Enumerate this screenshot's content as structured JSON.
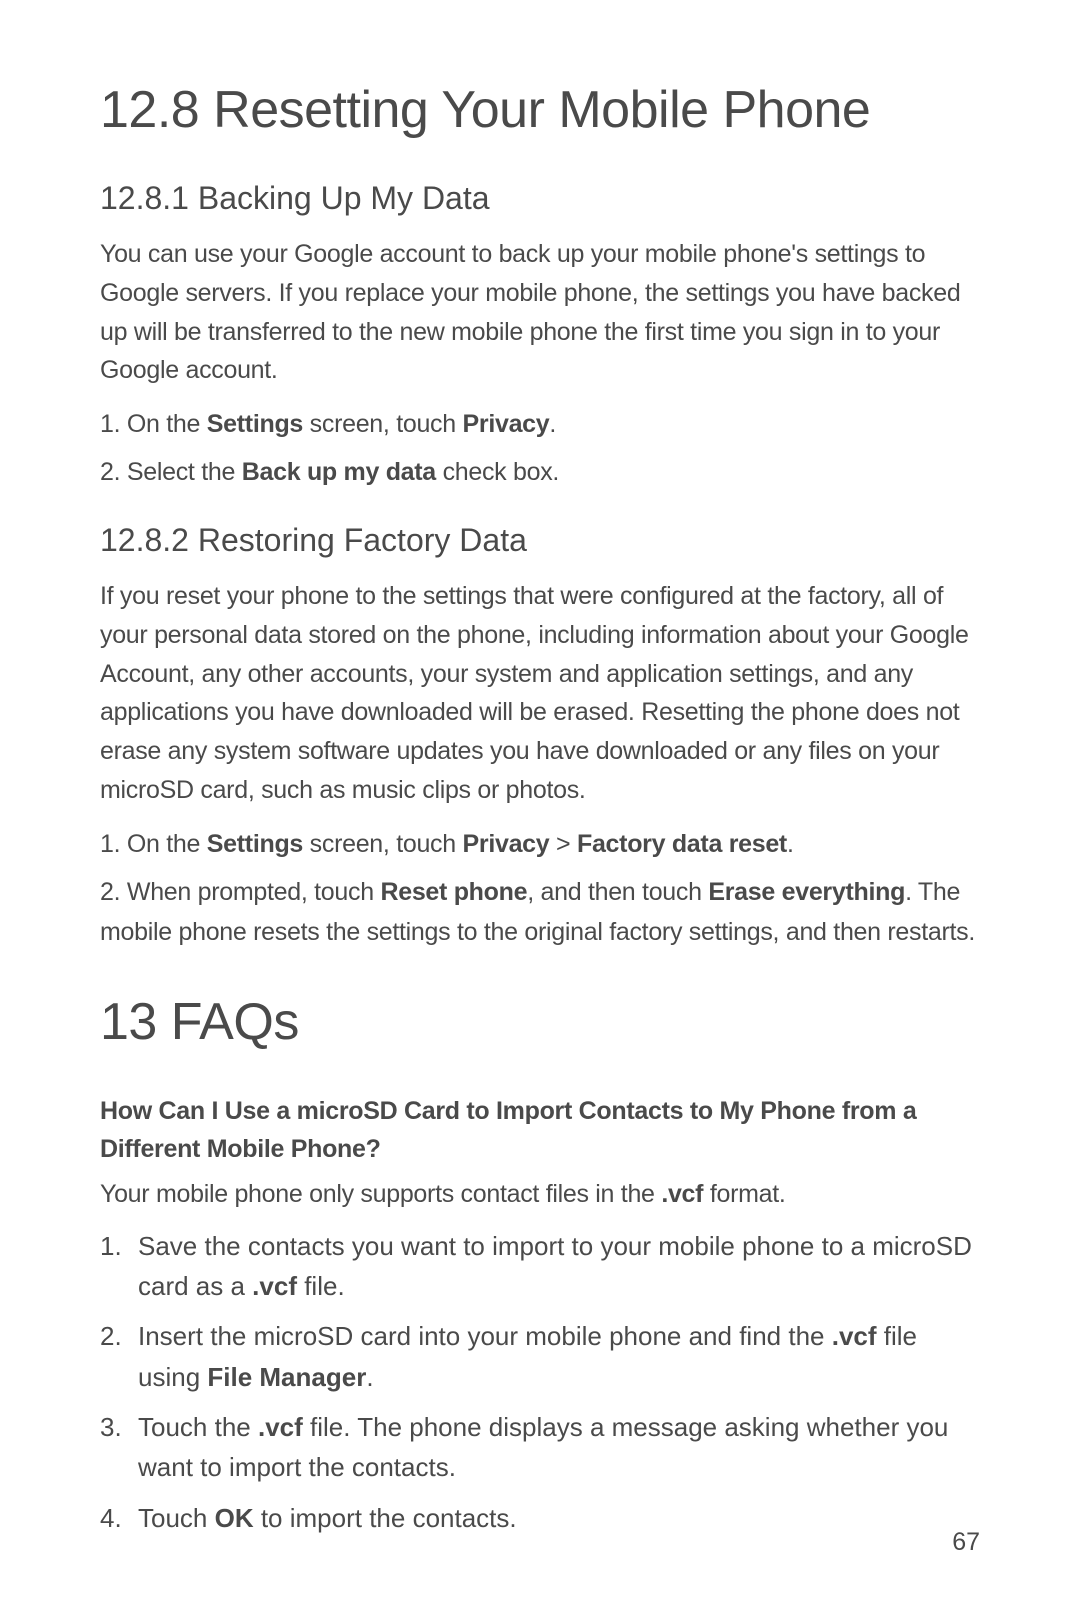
{
  "h1_main": "12.8  Resetting Your Mobile Phone",
  "s1": {
    "heading": "12.8.1  Backing Up My Data",
    "para": "You can use your Google account to back up your mobile phone's settings to Google servers. If you replace your mobile phone, the settings you have backed up will be transferred to the new mobile phone the first time you sign in to your Google account.",
    "step1_a": "1. On the ",
    "step1_b": "Settings",
    "step1_c": " screen, touch ",
    "step1_d": "Privacy",
    "step1_e": ".",
    "step2_a": "2. Select the ",
    "step2_b": "Back up my data",
    "step2_c": " check box."
  },
  "s2": {
    "heading": "12.8.2  Restoring Factory Data",
    "para": "If you reset your phone to the settings that were configured at the factory, all of your personal data stored on the phone, including information about your Google Account, any other accounts, your system and application settings, and any applications you have downloaded will be erased. Resetting the phone does not erase any system software updates you have downloaded or any files on your microSD card, such as music clips or photos.",
    "step1_a": "1. On the ",
    "step1_b": "Settings",
    "step1_c": " screen, touch ",
    "step1_d": "Privacy",
    "step1_e": " > ",
    "step1_f": "Factory data reset",
    "step1_g": ".",
    "step2_a": "2. When prompted, touch ",
    "step2_b": "Reset phone",
    "step2_c": ", and then touch ",
    "step2_d": "Erase everything",
    "step2_e": ". The mobile phone resets the settings to the original factory settings, and then restarts."
  },
  "h1_faq": "13  FAQs",
  "faq": {
    "q": "How Can I Use a microSD Card to Import Contacts to My Phone from a Different Mobile Phone?",
    "intro_a": "Your mobile phone only supports contact files in the ",
    "intro_b": ".vcf",
    "intro_c": " format.",
    "li1_num": "1.",
    "li1_a": "Save the contacts you want to import to your mobile phone to a microSD card as a ",
    "li1_b": ".vcf",
    "li1_c": " file.",
    "li2_num": "2.",
    "li2_a": "Insert the microSD card into your mobile phone and find the ",
    "li2_b": ".vcf",
    "li2_c": " file using ",
    "li2_d": "File Manager",
    "li2_e": ".",
    "li3_num": "3.",
    "li3_a": "Touch the ",
    "li3_b": ".vcf",
    "li3_c": " file. The phone displays a message asking whether you want to import the contacts.",
    "li4_num": "4.",
    "li4_a": "Touch ",
    "li4_b": "OK",
    "li4_c": " to import the contacts."
  },
  "page_number": "67"
}
